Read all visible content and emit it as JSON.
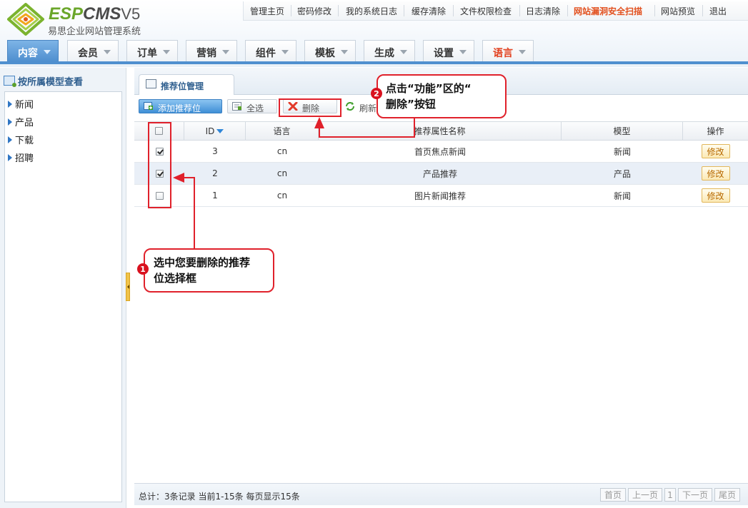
{
  "header": {
    "brand_esp": "ESP",
    "brand_cms": "CMS",
    "brand_version": "V5",
    "subtitle": "易思企业网站管理系统"
  },
  "topnav": [
    {
      "label": "管理主页"
    },
    {
      "label": "密码修改"
    },
    {
      "label": "我的系统日志"
    },
    {
      "label": "缓存清除"
    },
    {
      "label": "文件权限检查"
    },
    {
      "label": "日志清除"
    },
    {
      "label": "网站漏洞安全扫描"
    },
    {
      "label": "网站预览"
    },
    {
      "label": "退出"
    }
  ],
  "mainnav": [
    {
      "label": "内容"
    },
    {
      "label": "会员"
    },
    {
      "label": "订单"
    },
    {
      "label": "营销"
    },
    {
      "label": "组件"
    },
    {
      "label": "模板"
    },
    {
      "label": "生成"
    },
    {
      "label": "设置"
    },
    {
      "label": "语言"
    }
  ],
  "sidebar": {
    "title": "按所属模型查看",
    "items": [
      {
        "label": "新闻"
      },
      {
        "label": "产品"
      },
      {
        "label": "下载"
      },
      {
        "label": "招聘"
      }
    ]
  },
  "content": {
    "tab_label": "推荐位管理",
    "toolbar": {
      "add_label": "添加推荐位",
      "selectall_label": "全选",
      "delete_label": "删除",
      "refresh_label": "刷新"
    },
    "table": {
      "headers": {
        "id": "ID",
        "lang": "语言",
        "name": "推荐属性名称",
        "model": "模型",
        "action": "操作"
      },
      "rows": [
        {
          "checked": true,
          "id": "3",
          "lang": "cn",
          "name": "首页焦点新闻",
          "model": "新闻",
          "action": "修改"
        },
        {
          "checked": true,
          "id": "2",
          "lang": "cn",
          "name": "产品推荐",
          "model": "产品",
          "action": "修改"
        },
        {
          "checked": false,
          "id": "1",
          "lang": "cn",
          "name": "图片新闻推荐",
          "model": "新闻",
          "action": "修改"
        }
      ]
    },
    "footer": {
      "info": "总计：3条记录 当前1-15条 每页显示15条",
      "pager": {
        "first": "首页",
        "prev": "上一页",
        "page": "1",
        "next": "下一页",
        "last": "尾页"
      }
    }
  },
  "annotations": {
    "step1": {
      "num": "1",
      "line1": "选中您要删除的推荐",
      "line2": "位选择框"
    },
    "step2": {
      "num": "2",
      "line1": "点击“功能”区的“",
      "line2": "删除”按钮"
    }
  },
  "colors": {
    "accent": "#4f8fcf",
    "warn": "#e2501e",
    "annotation": "#e0212b"
  }
}
